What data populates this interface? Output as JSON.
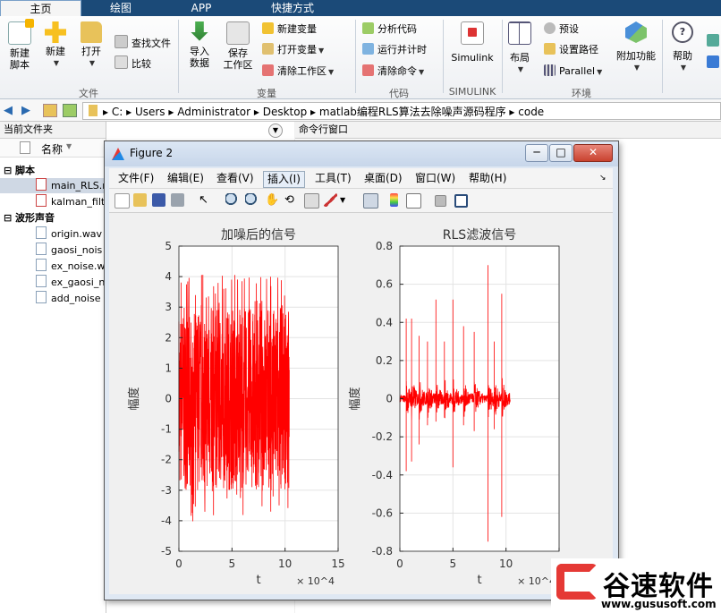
{
  "tabs": [
    "主页",
    "绘图",
    "APP",
    "快捷方式"
  ],
  "ribbon": {
    "new_script": "新建\n脚本",
    "new": "新建",
    "open": "打开",
    "find_files": "查找文件",
    "compare": "比较",
    "import": "导入\n数据",
    "save_ws": "保存\n工作区",
    "new_var": "新建变量",
    "open_var": "打开变量",
    "clear_ws": "清除工作区",
    "analyze": "分析代码",
    "run_time": "运行并计时",
    "clear_cmd": "清除命令",
    "simulink": "Simulink",
    "layout": "布局",
    "prefs": "预设",
    "set_path": "设置路径",
    "parallel": "Parallel",
    "addons": "附加功能",
    "help": "帮助",
    "groups": [
      "文件",
      "变量",
      "代码",
      "SIMULINK",
      "环境"
    ]
  },
  "address": [
    "C:",
    "Users",
    "Administrator",
    "Desktop",
    "matlab编程RLS算法去除噪声源码程序",
    "code"
  ],
  "left_panel": {
    "title": "当前文件夹",
    "col_name": "名称",
    "sections": [
      {
        "label": "脚本",
        "items": [
          "main_RLS.m",
          "kalman_filt"
        ]
      },
      {
        "label": "波形声音",
        "items": [
          "origin.wav",
          "gaosi_nois",
          "ex_noise.w",
          "ex_gaosi_n",
          "add_noise"
        ]
      }
    ]
  },
  "right_panel": {
    "title": "命令行窗口"
  },
  "figure": {
    "title": "Figure 2",
    "menu": [
      "文件(F)",
      "编辑(E)",
      "查看(V)",
      "插入(I)",
      "工具(T)",
      "桌面(D)",
      "窗口(W)",
      "帮助(H)"
    ],
    "ctrl_min": "─",
    "ctrl_max": "□",
    "ctrl_close": "✕",
    "toolbar_icons": [
      "new-figure-icon",
      "open-file-icon",
      "save-icon",
      "print-icon",
      "pointer-icon",
      "zoom-in-icon",
      "zoom-out-icon",
      "pan-icon",
      "rotate-icon",
      "data-cursor-icon",
      "brush-icon",
      "link-icon",
      "colorbar-icon",
      "legend-icon",
      "hide-plot-tools-icon",
      "show-plot-tools-icon"
    ]
  },
  "chart_data": [
    {
      "type": "line",
      "title": "加噪后的信号",
      "xlabel": "t",
      "ylabel": "幅度",
      "x_exponent_label": "× 10^4",
      "xlim": [
        0,
        15
      ],
      "ylim": [
        -5,
        5
      ],
      "xticks": [
        0,
        5,
        10,
        15
      ],
      "yticks": [
        -5,
        -4,
        -3,
        -2,
        -1,
        0,
        1,
        2,
        3,
        4,
        5
      ],
      "grid": true,
      "series": [
        {
          "color": "#ff0000",
          "x_range": [
            0,
            10.4
          ],
          "envelope": [
            -3.0,
            3.0
          ],
          "peaks": [
            -4.1,
            4.1
          ]
        }
      ]
    },
    {
      "type": "line",
      "title": "RLS滤波信号",
      "xlabel": "t",
      "ylabel": "幅度",
      "x_exponent_label": "× 10^4",
      "xlim": [
        0,
        15
      ],
      "ylim": [
        -0.8,
        0.8
      ],
      "xticks": [
        0,
        5,
        10,
        15
      ],
      "yticks": [
        -0.8,
        -0.6,
        -0.4,
        -0.2,
        0,
        0.2,
        0.4,
        0.6,
        0.8
      ],
      "grid": true,
      "series": [
        {
          "color": "#ff0000",
          "x_range": [
            0,
            10.4
          ],
          "spikes_x": [
            0.6,
            1.1,
            1.8,
            2.6,
            3.4,
            4.2,
            5.0,
            6.0,
            7.0,
            8.3,
            8.9,
            9.6
          ]
        }
      ]
    }
  ],
  "watermark": {
    "brand": "谷速软件",
    "url": "www.gususoft.com"
  }
}
